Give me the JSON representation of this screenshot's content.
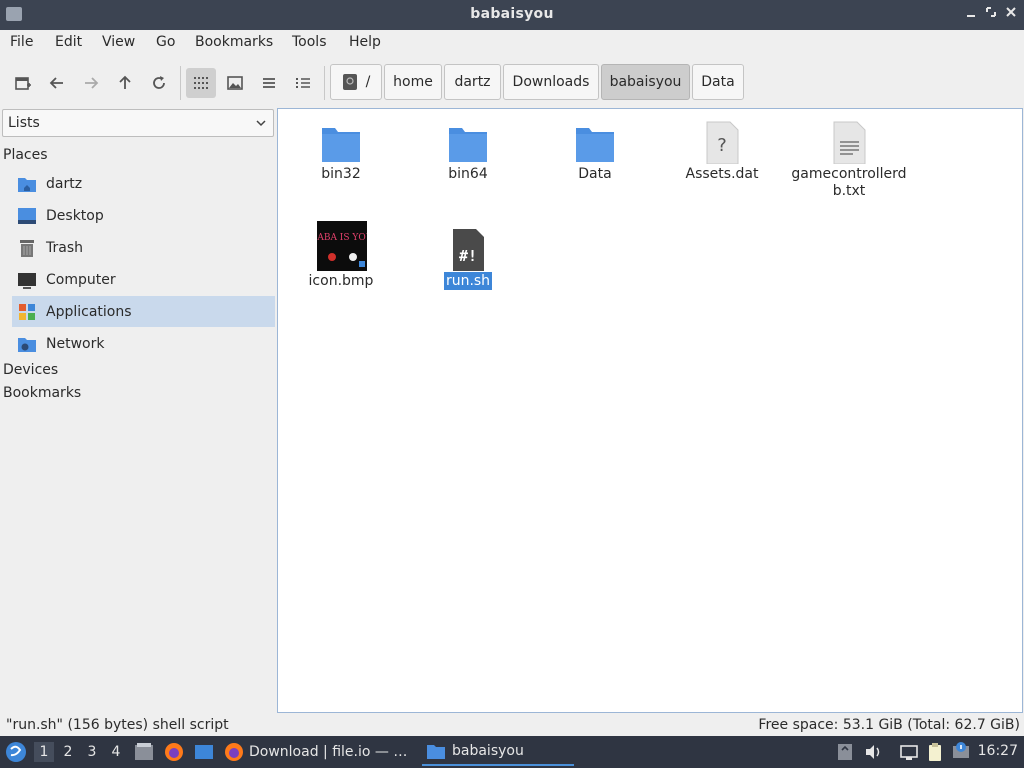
{
  "window": {
    "title": "babaisyou"
  },
  "menubar": {
    "items": [
      "File",
      "Edit",
      "View",
      "Go",
      "Bookmarks",
      "Tools",
      "Help"
    ]
  },
  "toolbar": {
    "buttons": [
      "new-tab-icon",
      "back-arrow-icon",
      "forward-arrow-icon",
      "up-arrow-icon",
      "reload-icon",
      "icon-view-icon",
      "thumbnail-view-icon",
      "compact-view-icon",
      "detailed-list-view-icon"
    ],
    "path_root": "/",
    "breadcrumbs": [
      "home",
      "dartz",
      "Downloads",
      "babaisyou",
      "Data"
    ],
    "active_crumb": "babaisyou"
  },
  "sidebar": {
    "mode": "Lists",
    "places_header": "Places",
    "places": [
      {
        "label": "dartz",
        "icon": "home-folder-icon"
      },
      {
        "label": "Desktop",
        "icon": "desktop-icon"
      },
      {
        "label": "Trash",
        "icon": "trash-icon"
      },
      {
        "label": "Computer",
        "icon": "computer-icon"
      },
      {
        "label": "Applications",
        "icon": "applications-icon",
        "selected": true
      },
      {
        "label": "Network",
        "icon": "network-icon"
      }
    ],
    "devices_header": "Devices",
    "bookmarks_header": "Bookmarks"
  },
  "files": [
    {
      "name": "bin32",
      "type": "folder"
    },
    {
      "name": "bin64",
      "type": "folder"
    },
    {
      "name": "Data",
      "type": "folder"
    },
    {
      "name": "Assets.dat",
      "type": "unknown"
    },
    {
      "name_line1": "gamecontrollerd",
      "name_line2": "b.txt",
      "type": "text"
    },
    {
      "name": "icon.bmp",
      "type": "image",
      "thumbnail_text": "BABA IS YOU"
    },
    {
      "name": "run.sh",
      "type": "script",
      "selected": true
    }
  ],
  "statusbar": {
    "left": "\"run.sh\" (156 bytes) shell script",
    "right": "Free space: 53.1 GiB (Total: 62.7 GiB)"
  },
  "taskbar": {
    "workspaces": [
      "1",
      "2",
      "3",
      "4"
    ],
    "active_workspace": "1",
    "tasks": [
      {
        "label": "Download | file.io — …",
        "icon": "firefox-icon"
      },
      {
        "label": "babaisyou",
        "icon": "folder-icon",
        "active": true
      }
    ],
    "clock": "16:27"
  },
  "colors": {
    "titlebar": "#3c4452",
    "taskbar": "#2f3542",
    "folder": "#4a8ee0",
    "selection": "#3d86d8",
    "sidebar_selected": "#c9d9ec"
  }
}
